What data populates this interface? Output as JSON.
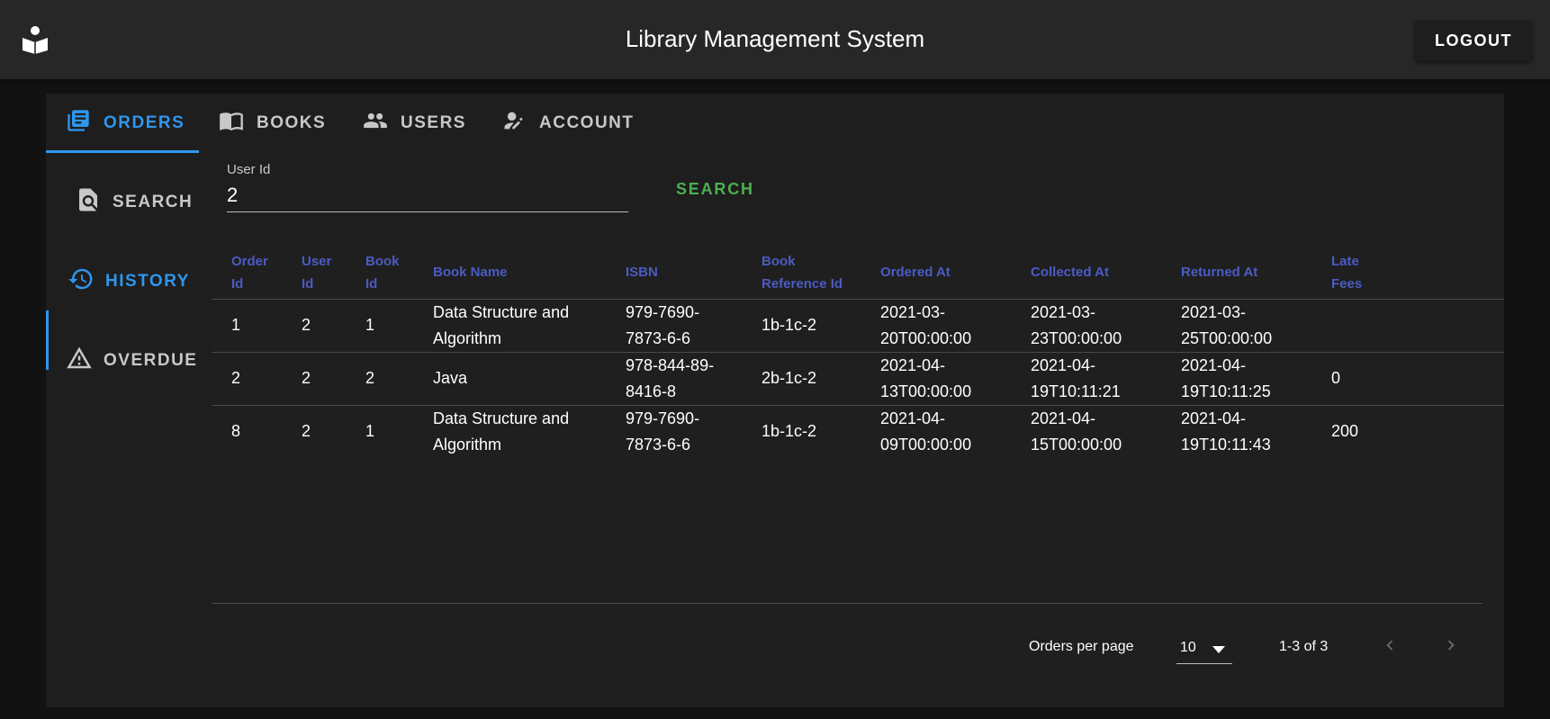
{
  "app": {
    "title": "Library Management System",
    "logout_label": "LOGOUT"
  },
  "tabs": [
    {
      "label": "ORDERS",
      "icon": "library-books-icon",
      "active": true
    },
    {
      "label": "BOOKS",
      "icon": "menu-book-icon",
      "active": false
    },
    {
      "label": "USERS",
      "icon": "people-icon",
      "active": false
    },
    {
      "label": "ACCOUNT",
      "icon": "person-edit-icon",
      "active": false
    }
  ],
  "sidenav": [
    {
      "label": "SEARCH",
      "icon": "find-in-page-icon",
      "active": false
    },
    {
      "label": "HISTORY",
      "icon": "history-icon",
      "active": true
    },
    {
      "label": "OVERDUE",
      "icon": "warning-icon",
      "active": false
    }
  ],
  "search": {
    "label": "User Id",
    "value": "2",
    "button_label": "SEARCH"
  },
  "table": {
    "headers": [
      [
        "Order",
        "Id"
      ],
      [
        "User",
        "Id"
      ],
      [
        "Book",
        "Id"
      ],
      [
        "Book Name"
      ],
      [
        "ISBN"
      ],
      [
        "Book",
        "Reference Id"
      ],
      [
        "Ordered At"
      ],
      [
        "Collected At"
      ],
      [
        "Returned At"
      ],
      [
        "Late",
        "Fees"
      ]
    ],
    "rows": [
      [
        [
          "1"
        ],
        [
          "2"
        ],
        [
          "1"
        ],
        [
          "Data Structure and",
          "Algorithm"
        ],
        [
          "979-7690-",
          "7873-6-6"
        ],
        [
          "1b-1c-2"
        ],
        [
          "2021-03-",
          "20T00:00:00"
        ],
        [
          "2021-03-",
          "23T00:00:00"
        ],
        [
          "2021-03-",
          "25T00:00:00"
        ],
        [
          ""
        ]
      ],
      [
        [
          "2"
        ],
        [
          "2"
        ],
        [
          "2"
        ],
        [
          "Java"
        ],
        [
          "978-844-89-",
          "8416-8"
        ],
        [
          "2b-1c-2"
        ],
        [
          "2021-04-",
          "13T00:00:00"
        ],
        [
          "2021-04-",
          "19T10:11:21"
        ],
        [
          "2021-04-",
          "19T10:11:25"
        ],
        [
          "0"
        ]
      ],
      [
        [
          "8"
        ],
        [
          "2"
        ],
        [
          "1"
        ],
        [
          "Data Structure and",
          "Algorithm"
        ],
        [
          "979-7690-",
          "7873-6-6"
        ],
        [
          "1b-1c-2"
        ],
        [
          "2021-04-",
          "09T00:00:00"
        ],
        [
          "2021-04-",
          "15T00:00:00"
        ],
        [
          "2021-04-",
          "19T10:11:43"
        ],
        [
          "200"
        ]
      ]
    ]
  },
  "pagination": {
    "per_page_label": "Orders per page",
    "per_page_value": "10",
    "range": "1-3 of 3"
  },
  "colors": {
    "accent": "#2f96ee",
    "header_text": "#4b5bc4",
    "search_button": "#4caf50"
  }
}
